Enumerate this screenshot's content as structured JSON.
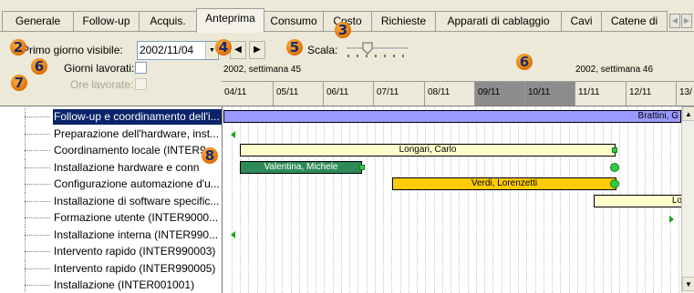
{
  "tabs": {
    "items": [
      "Generale",
      "Follow-up",
      "Acquis.",
      "Anteprima",
      "Consumo",
      "Costo",
      "Richieste",
      "Apparati di cablaggio",
      "Cavi",
      "Catene di"
    ],
    "active_index": 3
  },
  "controls": {
    "first_day_label": "Primo giorno visibile:",
    "first_day_value": "2002/11/04",
    "scale_label": "Scala:",
    "worked_days_label": "Giorni lavorati:",
    "worked_hours_label": "Ore lavorate:"
  },
  "timeline": {
    "weeks": [
      "2002, settimana 45",
      "2002, settimana 46"
    ],
    "days": [
      "04/11",
      "05/11",
      "06/11",
      "07/11",
      "08/11",
      "09/11",
      "10/11",
      "11/11",
      "12/11",
      "13/"
    ],
    "weekend_days": [
      "09/11",
      "10/11"
    ]
  },
  "tasks": [
    "Follow-up e coordinamento dell'i...",
    "Preparazione dell'hardware, inst...",
    "Coordinamento locale (INTER9",
    "Installazione hardware e conn",
    "Configurazione automazione d'u...",
    "Installazione di software specific...",
    "Formazione utente (INTER9000...",
    "Installazione interna (INTER990...",
    "Intervento rapido (INTER990003)",
    "Intervento rapido (INTER990005)",
    "Installazione (INTER001001)"
  ],
  "selected_task_index": 0,
  "bars": {
    "row0_label": "Brattini, G",
    "row2_label": "Longari, Carlo",
    "row3_label": "Valentina, Michele",
    "row4_label": "Verdi, Lorenzetti",
    "row5_label": "Lo"
  },
  "callouts": [
    "2",
    "3",
    "4",
    "5",
    "6",
    "6",
    "7",
    "8"
  ],
  "colors": {
    "row0_bar": "#9999ff",
    "row2_bar": "#ffffcc",
    "row3_bar": "#2e8b57",
    "row4_bar": "#ffcc00",
    "row5_bar": "#ffffcc",
    "selection": "#0a246a",
    "weekend": "#8c8c8c",
    "milestone": "#2ecc40"
  }
}
